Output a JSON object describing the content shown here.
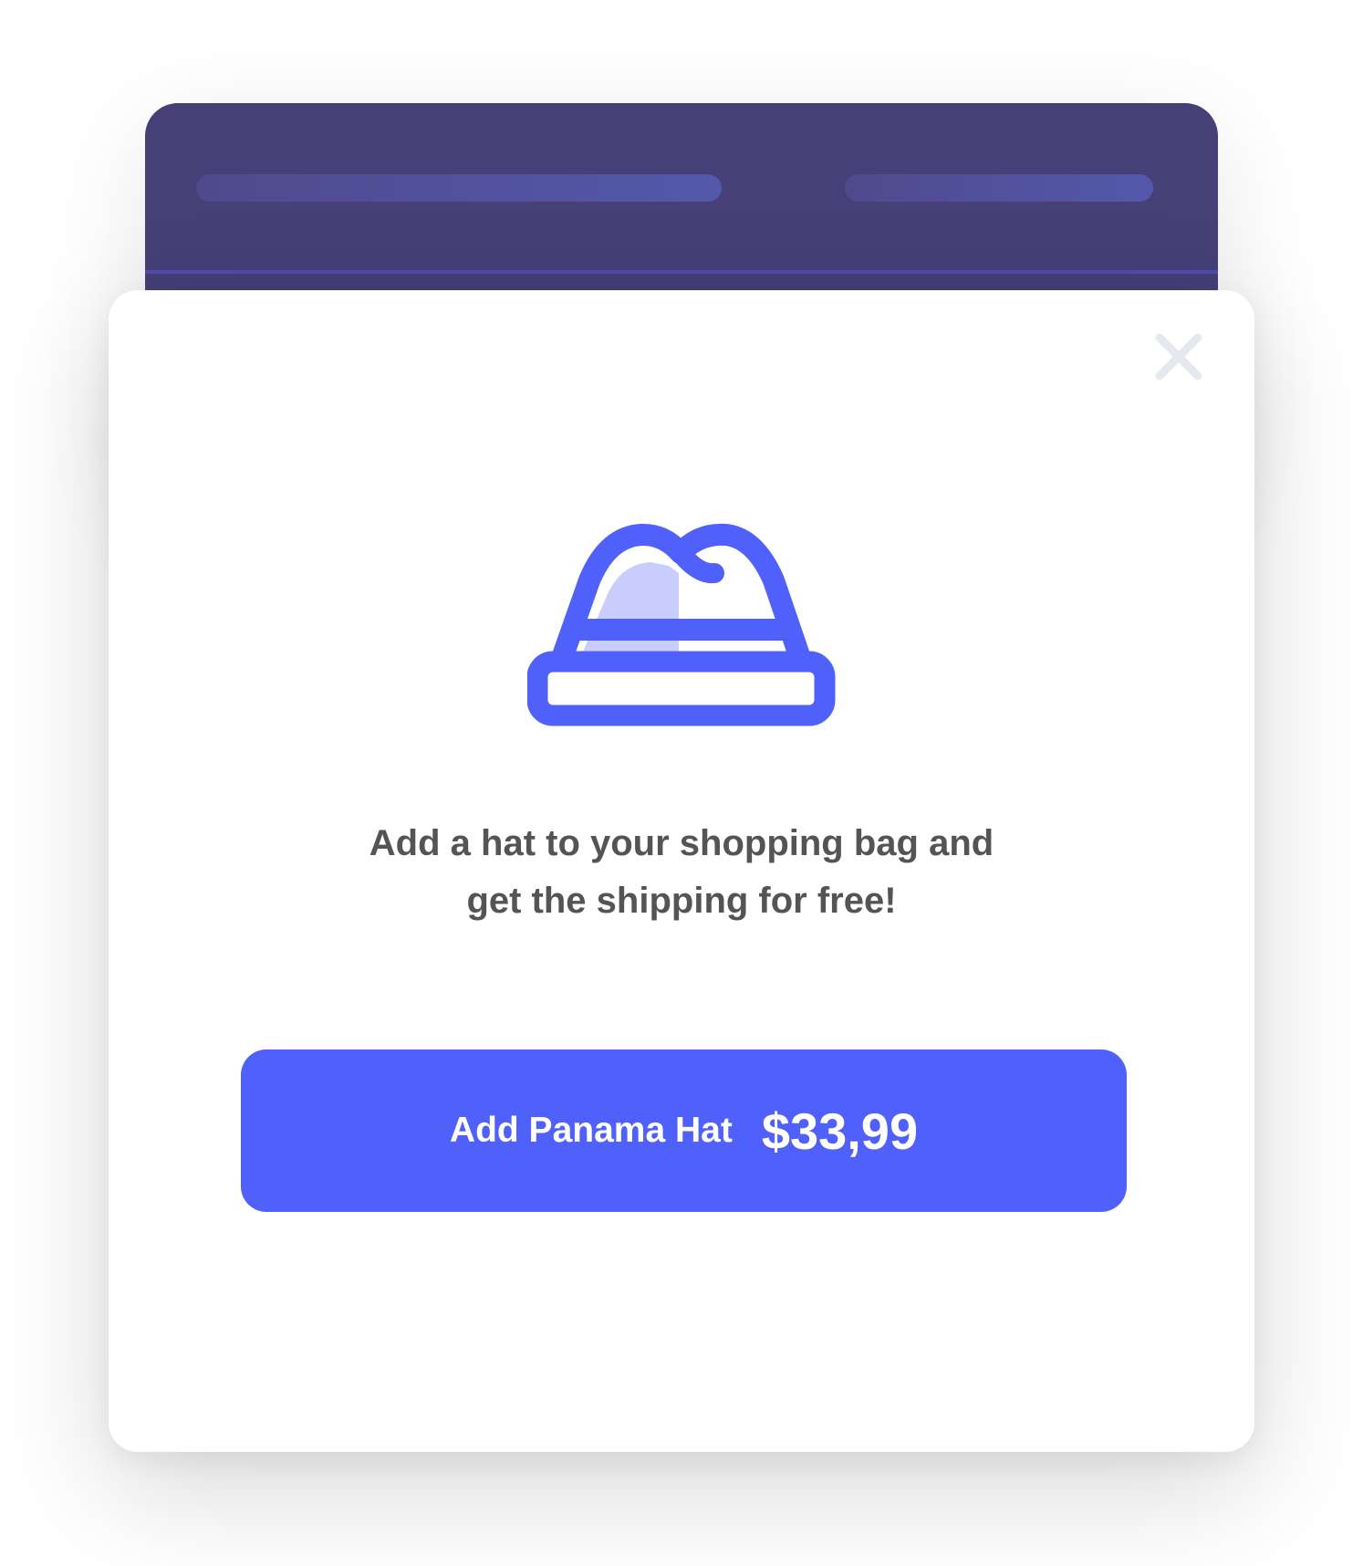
{
  "colors": {
    "header_bg": "#463f78",
    "accent": "#5060fb",
    "accent_light": "#c8cdfc",
    "text": "#545454",
    "close_icon": "#e6e8ef"
  },
  "modal": {
    "icon": "panama-hat-icon",
    "close_icon": "close-icon",
    "message_line1": "Add a hat to your shopping bag and",
    "message_line2": "get the shipping for free!",
    "cta": {
      "label": "Add Panama Hat",
      "price": "$33,99"
    }
  }
}
